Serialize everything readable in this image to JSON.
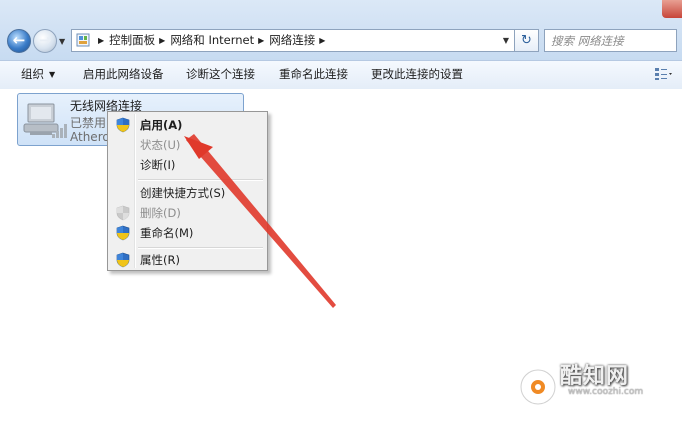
{
  "address_bar": {
    "breadcrumbs": [
      "控制面板",
      "网络和 Internet",
      "网络连接"
    ],
    "search_placeholder": "搜索 网络连接"
  },
  "toolbar": {
    "organize": "组织",
    "enable_device": "启用此网络设备",
    "diagnose": "诊断这个连接",
    "rename": "重命名此连接",
    "change_settings": "更改此连接的设置"
  },
  "connection": {
    "name": "无线网络连接",
    "status": "已禁用",
    "adapter": "Atheros"
  },
  "context_menu": {
    "items": [
      {
        "label": "启用(A)",
        "icon": "uac-shield-icon",
        "bold": true,
        "enabled": true
      },
      {
        "label": "状态(U)",
        "enabled": false
      },
      {
        "label": "诊断(I)",
        "enabled": true
      },
      {
        "label": "创建快捷方式(S)",
        "enabled": true
      },
      {
        "label": "删除(D)",
        "icon": "uac-shield-icon",
        "enabled": false
      },
      {
        "label": "重命名(M)",
        "icon": "uac-shield-icon",
        "enabled": true
      },
      {
        "label": "属性(R)",
        "icon": "uac-shield-icon",
        "enabled": true
      }
    ]
  },
  "annotation": {
    "arrow_color": "#e0392b",
    "points_to": "启用(A)"
  },
  "watermark": {
    "name": "酷知网",
    "url": "www.coozhi.com"
  },
  "colors": {
    "selection_bg": "#cfe2f7",
    "selection_border": "#7da2ce",
    "menu_bg": "#f0f0f0",
    "addrbar_bg": "#cfe0f3"
  }
}
